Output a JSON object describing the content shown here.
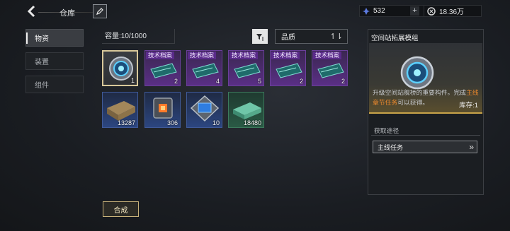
{
  "header": {
    "title": "仓库"
  },
  "resources": [
    {
      "icon": "crystal-icon",
      "value": "532"
    },
    {
      "icon": "coin-icon",
      "value": "18.36万"
    }
  ],
  "tabs": [
    {
      "label": "物资",
      "active": true
    },
    {
      "label": "装置",
      "active": false
    },
    {
      "label": "组件",
      "active": false
    }
  ],
  "capacity": "容量:10/1000",
  "sort": {
    "selected": "品质"
  },
  "items": [
    {
      "name": "空间站拓展模组",
      "tag": "",
      "count": "1",
      "quality": "gold",
      "icon": "gear-module-icon"
    },
    {
      "name": "技术档案",
      "tag": "技术档案",
      "count": "2",
      "quality": "purple",
      "icon": "blueprint-icon"
    },
    {
      "name": "技术档案",
      "tag": "技术档案",
      "count": "4",
      "quality": "purple",
      "icon": "blueprint-icon"
    },
    {
      "name": "技术档案",
      "tag": "技术档案",
      "count": "5",
      "quality": "purple",
      "icon": "blueprint-icon"
    },
    {
      "name": "技术档案",
      "tag": "技术档案",
      "count": "2",
      "quality": "purple",
      "icon": "blueprint-icon"
    },
    {
      "name": "技术档案",
      "tag": "技术档案",
      "count": "2",
      "quality": "purple",
      "icon": "blueprint-icon"
    },
    {
      "name": "",
      "tag": "",
      "count": "13287",
      "quality": "blue",
      "icon": "crate-icon"
    },
    {
      "name": "",
      "tag": "",
      "count": "306",
      "quality": "blue",
      "icon": "cube-core-icon"
    },
    {
      "name": "",
      "tag": "",
      "count": "10",
      "quality": "blue",
      "icon": "chip-icon"
    },
    {
      "name": "",
      "tag": "",
      "count": "18480",
      "quality": "green",
      "icon": "alloy-bar-icon"
    }
  ],
  "detail": {
    "title": "空间站拓展模组",
    "stock": "库存:1",
    "desc_pre": "升级空间站舰桥的重要构件。完成",
    "desc_hl": "主线章节任务",
    "desc_post": "可以获得。",
    "source_heading": "获取途径",
    "source_button": "主线任务"
  },
  "synth_button": "合成",
  "colors": {
    "highlight": "#ee8a2c",
    "purple": "#5a2f86",
    "blue": "#2c4680",
    "green": "#2a5a45",
    "gold_border": "#d8c89a"
  }
}
